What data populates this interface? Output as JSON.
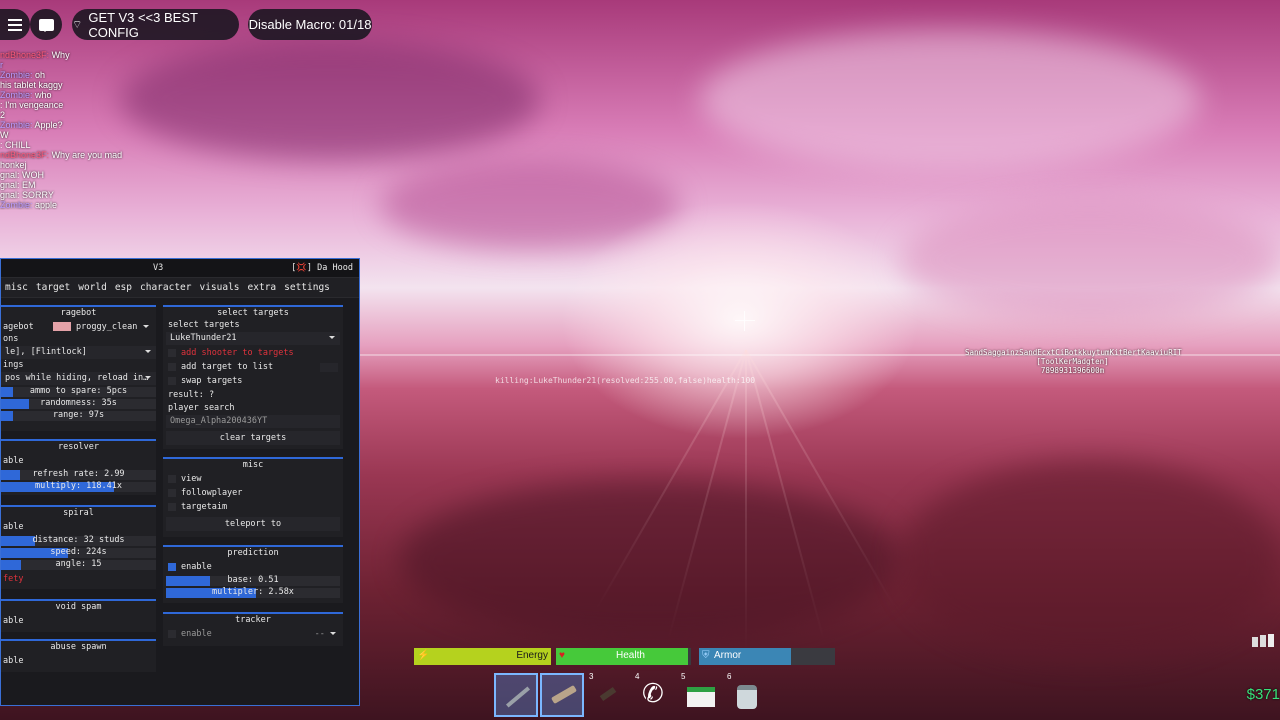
{
  "topbar": {
    "config_label": "GET V3 <<3 BEST CONFIG",
    "macro_label": "Disable Macro: 01/18"
  },
  "chat": [
    {
      "name": "ndBhone3F:",
      "msg": "Why",
      "name_color": "red"
    },
    {
      "name": "r",
      "msg": "",
      "name_color": "blue"
    },
    {
      "name": "Zombie:",
      "msg": "oh",
      "name_color": "blue"
    },
    {
      "name": "",
      "msg": "his tablet kaggy",
      "name_color": ""
    },
    {
      "name": "Zombie:",
      "msg": "who",
      "name_color": "blue"
    },
    {
      "name": "",
      "msg": ": I'm vengeance",
      "name_color": ""
    },
    {
      "name": "",
      "msg": "2",
      "name_color": ""
    },
    {
      "name": "Zombie:",
      "msg": "Apple?",
      "name_color": "blue"
    },
    {
      "name": "",
      "msg": "W",
      "name_color": ""
    },
    {
      "name": "",
      "msg": ": CHILL",
      "name_color": ""
    },
    {
      "name": "ndBhone3F:",
      "msg": "Why are you mad",
      "name_color": "red"
    },
    {
      "name": "",
      "msg": "honkej",
      "name_color": ""
    },
    {
      "name": "",
      "msg": "gnal: WOH",
      "name_color": ""
    },
    {
      "name": "",
      "msg": "gnal: EM",
      "name_color": ""
    },
    {
      "name": "",
      "msg": "gnal: SORRY",
      "name_color": ""
    },
    {
      "name": "Zombie:",
      "msg": "apple",
      "name_color": "blue"
    }
  ],
  "panel": {
    "version": "V3",
    "game": "[💢] Da Hood",
    "tabs": [
      "misc",
      "target",
      "world",
      "esp",
      "character",
      "visuals",
      "extra",
      "settings"
    ],
    "ragebot": {
      "title": "ragebot",
      "label": "agebot",
      "config": "proggy_clean",
      "options_label": "ons",
      "weapons": "le], [Flintlock]",
      "settings_label": "ings",
      "mode": "pos while hiding, reload in…",
      "ammo": "ammo to spare: 5pcs",
      "ammo_pct": 0.08,
      "randomness": "randomness: 35s",
      "randomness_pct": 0.18,
      "range": "range: 97s",
      "range_pct": 0.08
    },
    "resolver": {
      "title": "resolver",
      "enable": "able",
      "refresh": "refresh rate: 2.99",
      "refresh_pct": 0.12,
      "multiply": "multiply: 118.41x",
      "multiply_pct": 0.73
    },
    "spiral": {
      "title": "spiral",
      "enable": "able",
      "distance": "distance: 32 studs",
      "distance_pct": 0.22,
      "speed": "speed: 224s",
      "speed_pct": 0.43,
      "angle": "angle: 15",
      "angle_pct": 0.13,
      "safety": "fety"
    },
    "void_spam": {
      "title": "void spam",
      "enable": "able"
    },
    "abuse_spawn": {
      "title": "abuse spawn",
      "enable": "able"
    },
    "select_targets": {
      "title": "select targets",
      "label": "select targets",
      "selected": "LukeThunder21",
      "add_shooter": "add shooter to targets",
      "add_target": "add target to list",
      "swap": "swap targets",
      "result": "result: ?",
      "player_search": "player search",
      "search_value": "Omega_Alpha200436YT",
      "clear": "clear targets"
    },
    "misc": {
      "title": "misc",
      "view": "view",
      "followplayer": "followplayer",
      "targetaim": "targetaim",
      "teleport": "teleport to"
    },
    "prediction": {
      "title": "prediction",
      "enable": "enable",
      "base": "base: 0.51",
      "base_pct": 0.25,
      "multiplier": "multipler: 2.58x",
      "multiplier_pct": 0.52
    },
    "tracker": {
      "title": "tracker",
      "enable": "enable",
      "select": "--"
    }
  },
  "world": {
    "kill_text": "killing:LukeThunder21(resolved:255.00,false)health:100",
    "esp_lines": [
      "SandSaggainzSandEcxtCiBotkkuytumKitBertKaaviuRIT",
      "[ToolKerMadgten]",
      "7898931396600m"
    ]
  },
  "hud": {
    "energy": "Energy",
    "energy_pct": 1.0,
    "health": "Health",
    "health_pct": 0.98,
    "armor": "Armor",
    "armor_pct": 0.68,
    "slots": [
      "",
      "",
      "3",
      "4",
      "5",
      "6"
    ],
    "money": "$371"
  },
  "colors": {
    "accent": "#2f68d8",
    "energy": "#b5d21e",
    "health": "#46c93a",
    "armor": "#3b86b5",
    "money": "#38e07a"
  }
}
